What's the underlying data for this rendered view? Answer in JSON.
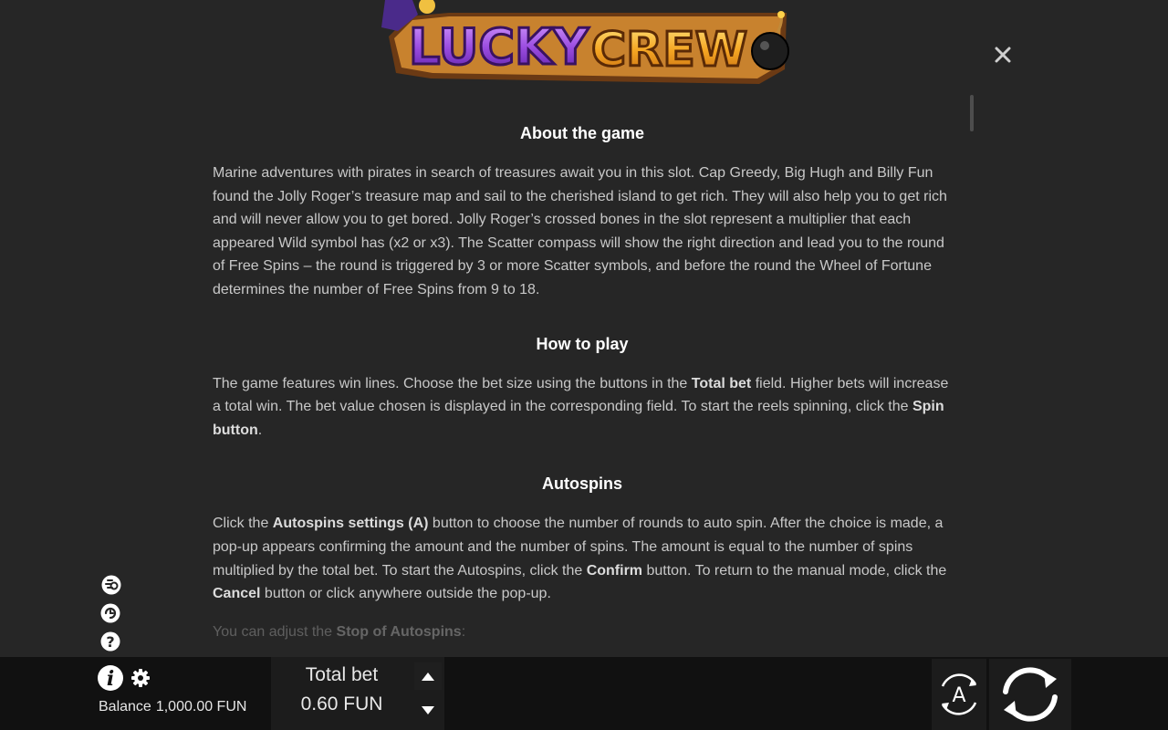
{
  "logo": {
    "word1": "LUCKY",
    "word2": "CREW"
  },
  "content": {
    "about": {
      "title": "About the game",
      "text": "Marine adventures with pirates in search of treasures await you in this slot. Cap Greedy, Big Hugh and Billy Fun found the Jolly Roger’s treasure map and sail to the cherished island to get rich. They will also help you to get rich and will never allow you to get bored. Jolly Roger’s crossed bones in the slot represent a multiplier that each appeared Wild symbol has (x2 or x3). The Scatter compass will show the right direction and lead you to the round of Free Spins – the round is triggered by 3 or more Scatter symbols, and before the round the Wheel of Fortune determines the number of Free Spins from 9 to 18."
    },
    "howto": {
      "title": "How to play",
      "t1": "The game features win lines. Choose the bet size using the buttons in the ",
      "b1": "Total bet",
      "t2": " field. Higher bets will increase a total win. The bet value chosen is displayed in the corresponding field. To start the reels spinning, click the ",
      "b2": "Spin button",
      "t3": "."
    },
    "autospins": {
      "title": "Autospins",
      "t1": "Click the ",
      "b1": "Autospins settings (A)",
      "t2": " button to choose the number of rounds to auto spin. After the choice is made, a pop-up appears confirming the amount and the number of spins. The amount is equal to the number of spins multiplied by the total bet. To start the Autospins, click the ",
      "b2": "Confirm",
      "t3": " button. To return to the manual mode, click the ",
      "b3": "Cancel",
      "t4": " button or click anywhere outside the pop-up.",
      "stop_t1": "You can adjust the ",
      "stop_b1": "Stop of Autospins",
      "stop_t2": ":"
    }
  },
  "bottom": {
    "balance_label": "Balance",
    "balance_value": "1,000.00 FUN",
    "bet_label": "Total bet",
    "bet_value": "0.60 FUN",
    "autospin_letter": "A"
  },
  "icons": {
    "close": "close-icon",
    "turbo": "turbo-icon",
    "quickspin": "quick-spin-icon",
    "help": "help-icon",
    "info": "info-icon",
    "settings": "gear-icon",
    "bet_up": "triangle-up-icon",
    "bet_down": "triangle-down-icon",
    "spin": "spin-arrows-icon"
  },
  "colors": {
    "background": "#262626",
    "bottom_bar": "#111111",
    "title_text": "#ffffff",
    "body_text": "#c8c8c8",
    "logo_purple": "#9b4de0",
    "logo_orange": "#f5a623"
  }
}
